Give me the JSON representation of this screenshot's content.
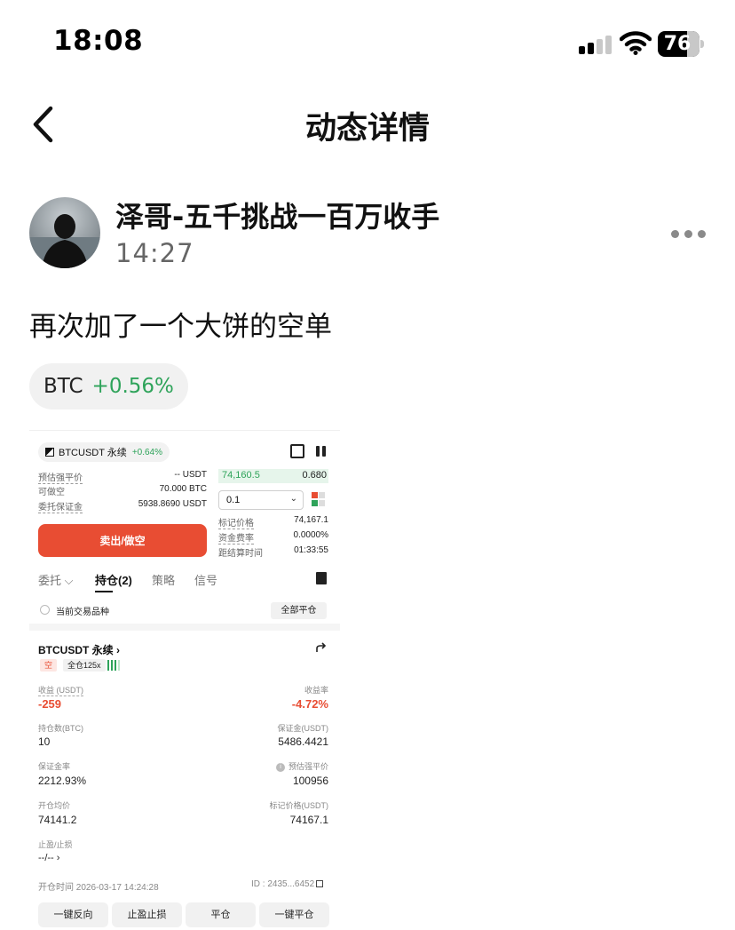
{
  "status_bar": {
    "time": "18:08",
    "battery": "76"
  },
  "nav": {
    "title": "动态详情"
  },
  "post": {
    "author": "泽哥-五千挑战一百万收手",
    "time": "14:27",
    "text": "再次加了一个大饼的空单",
    "coin": {
      "symbol": "BTC",
      "change": "+0.56%",
      "change_color": "#2ea35a"
    }
  },
  "screenshot": {
    "pair": {
      "name": "BTCUSDT 永续",
      "change": "+0.64%"
    },
    "account": {
      "liq_price_label": "预估强平价",
      "liq_price_value": "-- USDT",
      "available_short_label": "可做空",
      "available_short_value": "70.000 BTC",
      "order_margin_label": "委托保证金",
      "order_margin_value": "5938.8690 USDT"
    },
    "orderbook": {
      "price": "74,160.5",
      "qty": "0.680"
    },
    "lot_select": "0.1",
    "market_info": {
      "mark_price_label": "标记价格",
      "mark_price_value": "74,167.1",
      "funding_rate_label": "资金费率",
      "funding_rate_value": "0.0000%",
      "settle_label": "距结算时间",
      "settle_value": "01:33:55"
    },
    "sell_button": "卖出/做空",
    "tabs": [
      "委托 ⌵",
      "持仓(2)",
      "策略",
      "信号"
    ],
    "filter_label": "当前交易品种",
    "close_all_button": "全部平仓",
    "position": {
      "title": "BTCUSDT 永续 ›",
      "side_tag": "空",
      "leverage_tag": "全仓125x",
      "pnl_label": "收益 (USDT)",
      "pnl_value": "-259",
      "roe_label": "收益率",
      "roe_value": "-4.72%",
      "size_label": "持仓数(BTC)",
      "size_value": "10",
      "margin_label": "保证金(USDT)",
      "margin_value": "5486.4421",
      "margin_ratio_label": "保证金率",
      "margin_ratio_value": "2212.93%",
      "est_liq_label": "预估强平价",
      "est_liq_value": "100956",
      "entry_label": "开仓均价",
      "entry_value": "74141.2",
      "mark_label": "标记价格(USDT)",
      "mark_value": "74167.1",
      "tpsl_label": "止盈/止损",
      "tpsl_value": "--/-- ›",
      "open_time": "开仓时间 2026-03-17 14:24:28",
      "id": "ID : 2435...6452"
    },
    "actions": [
      "一键反向",
      "止盈止损",
      "平仓",
      "一键平仓"
    ]
  }
}
